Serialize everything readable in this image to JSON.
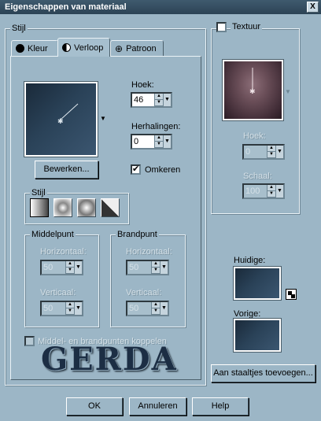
{
  "window": {
    "title": "Eigenschappen van materiaal",
    "close_label": "X"
  },
  "style_group": {
    "legend": "Stijl"
  },
  "tabs": [
    {
      "label": "Kleur",
      "icon": "filled-circle-icon"
    },
    {
      "label": "Verloop",
      "icon": "half-circle-icon"
    },
    {
      "label": "Patroon",
      "icon": "pattern-globe-icon"
    }
  ],
  "gradient": {
    "angle_label": "Hoek:",
    "angle_value": "46",
    "repeats_label": "Herhalingen:",
    "repeats_value": "0",
    "edit_button": "Bewerken...",
    "invert_label": "Omkeren",
    "invert_checked": "✔",
    "substyle_legend": "Stijl",
    "center": {
      "legend": "Middelpunt",
      "horizontal_label": "Horizontaal:",
      "horizontal_value": "50",
      "vertical_label": "Verticaal:",
      "vertical_value": "50"
    },
    "focal": {
      "legend": "Brandpunt",
      "horizontal_label": "Horizontaal:",
      "horizontal_value": "50",
      "vertical_label": "Verticaal:",
      "vertical_value": "50"
    },
    "link_label": "Middel- en brandpunten koppelen"
  },
  "texture": {
    "checkbox_label": "Textuur",
    "angle_label": "Hoek:",
    "angle_value": "0",
    "scale_label": "Schaal:",
    "scale_value": "100"
  },
  "current": {
    "label": "Huidige:"
  },
  "previous": {
    "label": "Vorige:"
  },
  "add_swatch_button": "Aan staaltjes toevoegen...",
  "watermark": "GERDA",
  "buttons": {
    "ok": "OK",
    "cancel": "Annuleren",
    "help": "Help"
  },
  "colors": {
    "gradient_dark": "#1a2a3a",
    "gradient_light": "#3b5670",
    "background": "#9cb6c6"
  }
}
